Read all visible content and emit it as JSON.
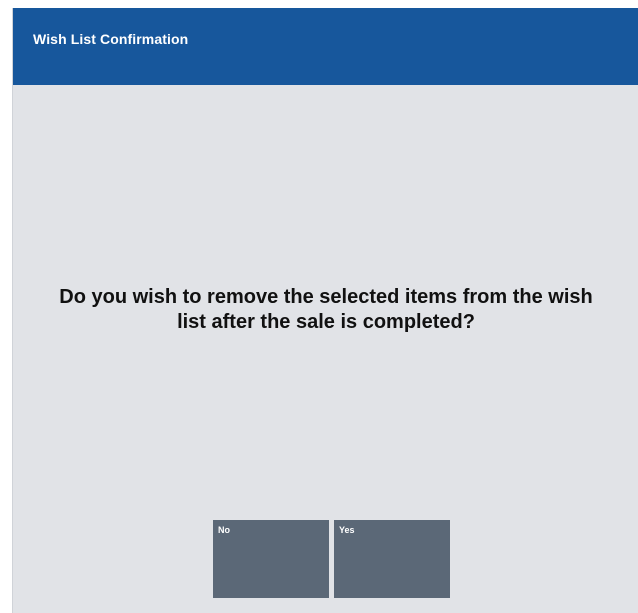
{
  "dialog": {
    "title": "Wish List Confirmation",
    "message_line1": "Do you wish to remove the selected items from the wish",
    "message_line2": "list after the sale is completed?",
    "colors": {
      "title_bar": "#17579c",
      "background": "#e1e3e7",
      "button": "#5b6877"
    }
  },
  "buttons": {
    "no_label": "No",
    "yes_label": "Yes"
  }
}
